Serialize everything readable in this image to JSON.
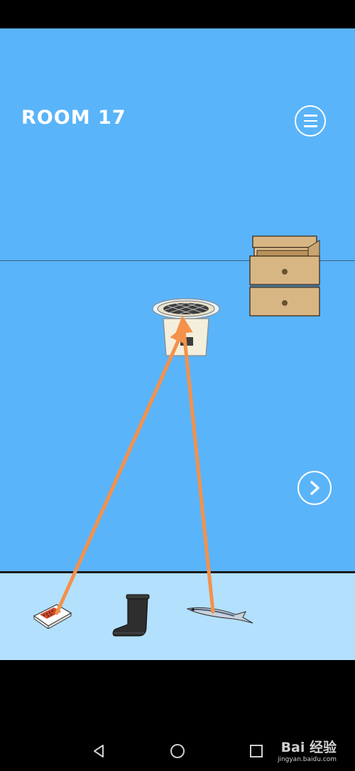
{
  "room": {
    "title": "ROOM 17"
  },
  "menu": {
    "icon": "menu-icon"
  },
  "navigation": {
    "next_icon": "chevron-right-icon"
  },
  "scene": {
    "objects": [
      "stacked-drawers",
      "charcoal-grill"
    ]
  },
  "inventory": {
    "items": [
      "matchbox",
      "black-boot",
      "fish"
    ]
  },
  "hint_arrows": {
    "color": "#f4914b"
  },
  "system_nav": {
    "back": "back-icon",
    "home": "home-icon",
    "recents": "recents-icon"
  },
  "watermark": {
    "brand": "Bai 经验",
    "url": "jingyan.baidu.com"
  },
  "colors": {
    "sky": "#5ab4f9",
    "floor": "#b3e0fc",
    "arrow": "#f4914b",
    "wood": "#d8b684"
  }
}
